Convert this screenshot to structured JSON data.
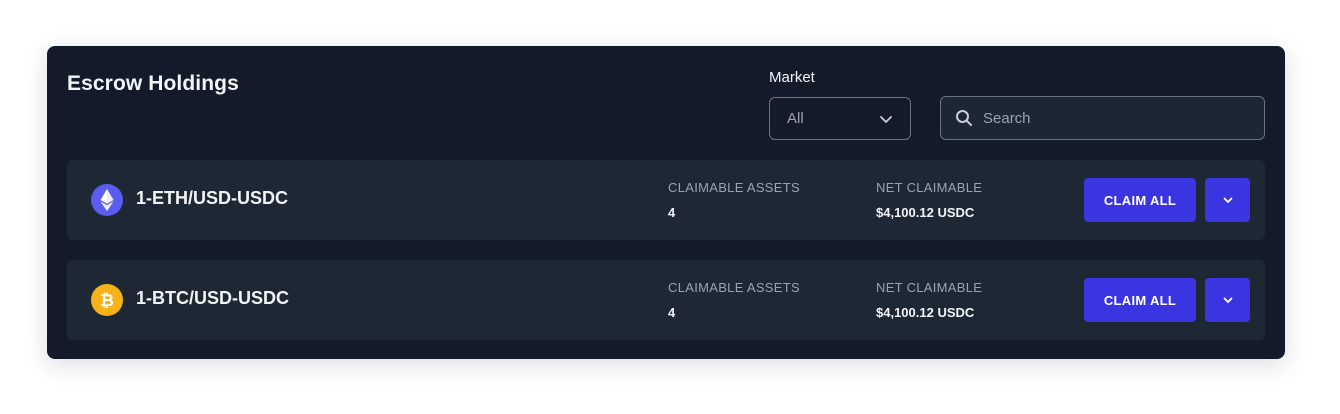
{
  "panel": {
    "title": "Escrow Holdings"
  },
  "filters": {
    "market_label": "Market",
    "market_value": "All",
    "search_placeholder": "Search"
  },
  "rows": [
    {
      "market": "1-ETH/USD-USDC",
      "icon": "ethereum-icon",
      "icon_color": "#5b5cf0",
      "claimable_assets_label": "CLAIMABLE ASSETS",
      "claimable_assets_value": "4",
      "net_claimable_label": "NET CLAIMABLE",
      "net_claimable_value": "$4,100.12 USDC",
      "claim_label": "CLAIM ALL",
      "expand_icon": "chevron-down-icon"
    },
    {
      "market": "1-BTC/USD-USDC",
      "icon": "bitcoin-icon",
      "icon_color": "#f7b21a",
      "claimable_assets_label": "CLAIMABLE ASSETS",
      "claimable_assets_value": "4",
      "net_claimable_label": "NET CLAIMABLE",
      "net_claimable_value": "$4,100.12 USDC",
      "claim_label": "CLAIM ALL",
      "expand_icon": "chevron-down-icon"
    }
  ],
  "colors": {
    "panel_bg": "#131a29",
    "row_bg": "#1e2835",
    "accent": "#3a35e0",
    "text_primary": "#f2f4f8",
    "text_muted": "#9aa3b2"
  }
}
